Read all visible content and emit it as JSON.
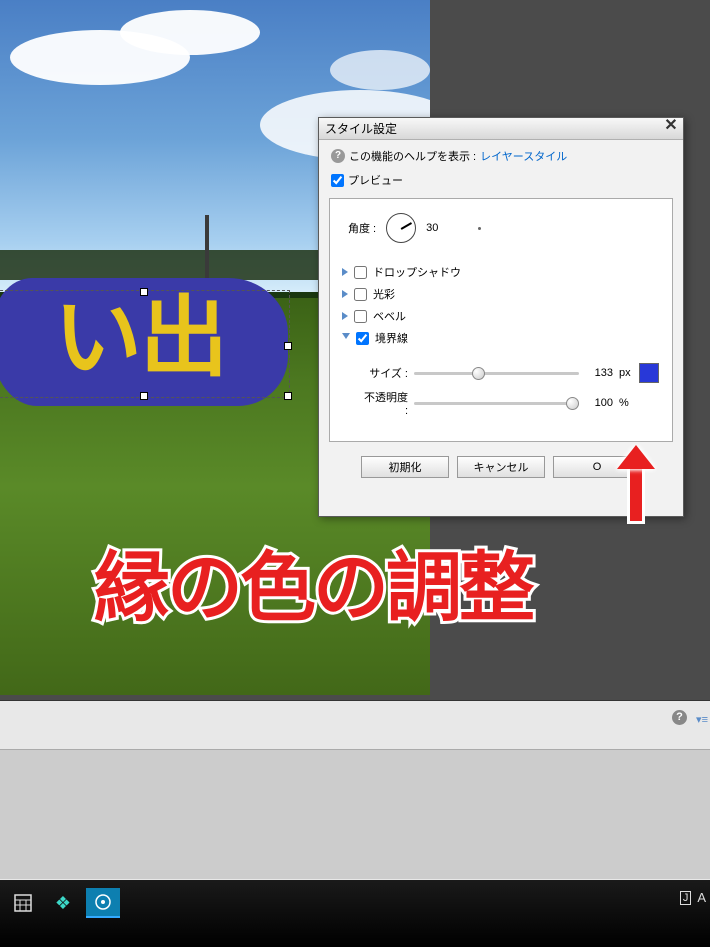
{
  "dialog": {
    "title": "スタイル設定",
    "help_prefix": "この機能のヘルプを表示 :",
    "help_link": "レイヤースタイル",
    "preview_label": "プレビュー",
    "angle_label": "角度 :",
    "angle_value": "30",
    "effects": {
      "drop_shadow": "ドロップシャドウ",
      "glow": "光彩",
      "bevel": "ベベル",
      "stroke": "境界線"
    },
    "stroke": {
      "size_label": "サイズ :",
      "size_value": "133",
      "size_unit": "px",
      "opacity_label": "不透明度 :",
      "opacity_value": "100",
      "opacity_unit": "%",
      "color": "#2838d8"
    },
    "buttons": {
      "reset": "初期化",
      "cancel": "キャンセル",
      "ok": "O"
    }
  },
  "canvas_text": "い出",
  "annotation": "縁の色の調整",
  "taskbar": {
    "right_text": "A"
  }
}
